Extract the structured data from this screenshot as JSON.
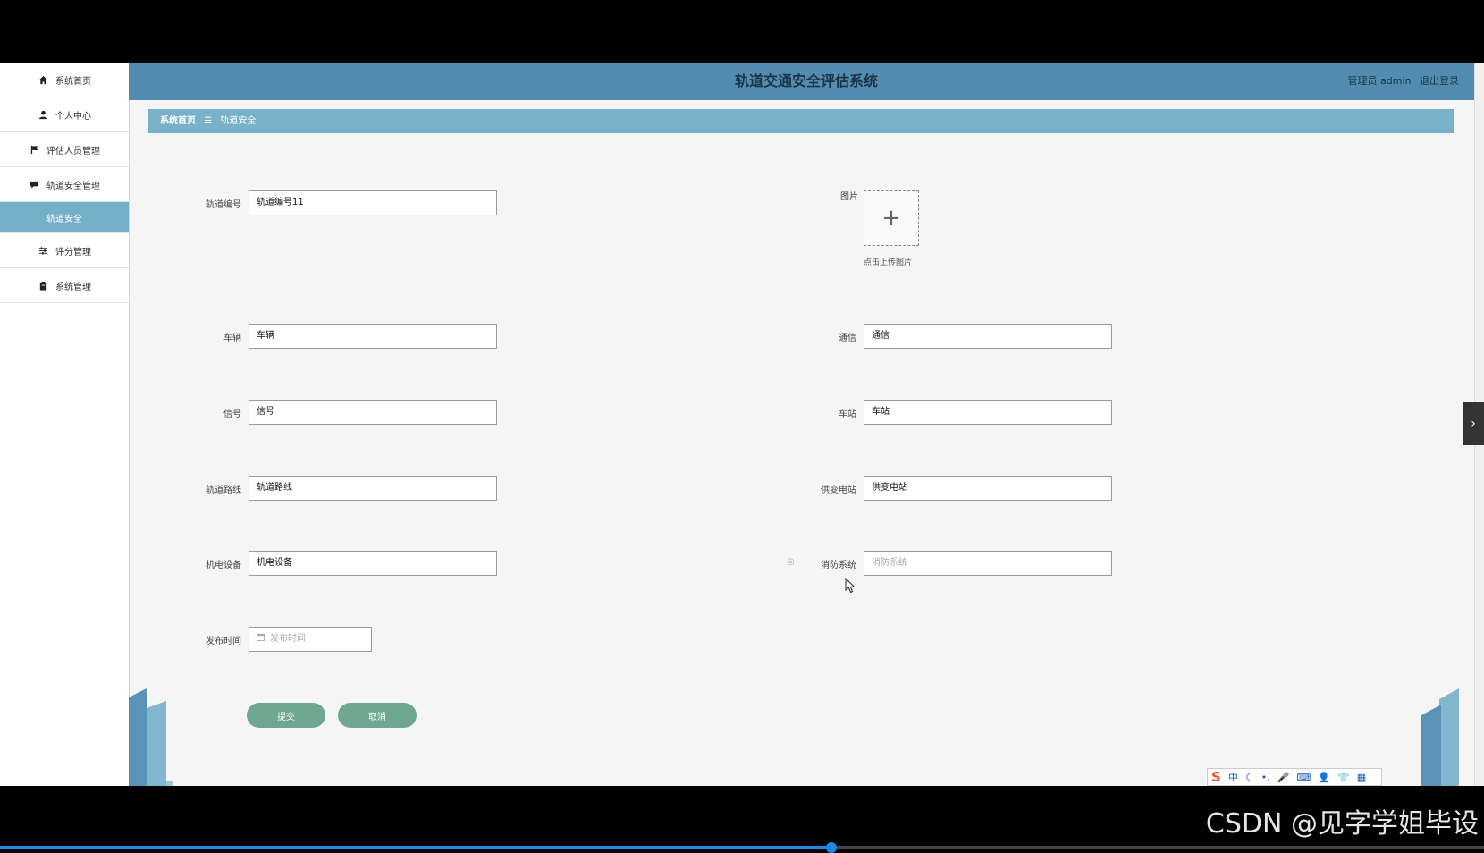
{
  "header": {
    "title": "轨道交通安全评估系统",
    "role": "管理员 admin",
    "logout": "退出登录"
  },
  "sidebar": {
    "items": [
      {
        "label": "系统首页",
        "icon": "home-icon"
      },
      {
        "label": "个人中心",
        "icon": "user-icon"
      },
      {
        "label": "评估人员管理",
        "icon": "flag-icon"
      },
      {
        "label": "轨道安全管理",
        "icon": "chat-icon"
      },
      {
        "label": "轨道安全",
        "icon": ""
      },
      {
        "label": "评分管理",
        "icon": "sliders-icon"
      },
      {
        "label": "系统管理",
        "icon": "clipboard-icon"
      }
    ]
  },
  "breadcrumb": {
    "home": "系统首页",
    "separator": "☰",
    "current": "轨道安全"
  },
  "form": {
    "track_no": {
      "label": "轨道编号",
      "value": "轨道编号11"
    },
    "image": {
      "label": "图片",
      "hint": "点击上传图片"
    },
    "vehicle": {
      "label": "车辆",
      "value": "车辆"
    },
    "comm": {
      "label": "通信",
      "value": "通信"
    },
    "signal": {
      "label": "信号",
      "value": "信号"
    },
    "station": {
      "label": "车站",
      "value": "车站"
    },
    "route": {
      "label": "轨道路线",
      "value": "轨道路线"
    },
    "substation": {
      "label": "供变电站",
      "value": "供变电站"
    },
    "equipment": {
      "label": "机电设备",
      "value": "机电设备"
    },
    "fire": {
      "label": "消防系统",
      "placeholder": "消防系统"
    },
    "publish_time": {
      "label": "发布时间",
      "placeholder": "发布时间"
    },
    "submit": "提交",
    "cancel": "取消"
  },
  "ime": {
    "lang": "中"
  },
  "watermark": "CSDN @见字学姐毕设",
  "video_progress": 0.56,
  "colors": {
    "header": "#528cb0",
    "breadcrumb": "#78b1c8",
    "active_nav": "#74afc8",
    "button": "#6fa890"
  }
}
